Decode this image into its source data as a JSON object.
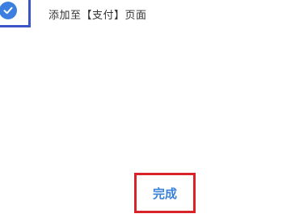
{
  "option": {
    "label": "添加至【支付】页面",
    "checked": true,
    "check_icon": "checkmark-icon",
    "check_color": "#3d7fe0",
    "highlight_color": "#3b55c9"
  },
  "footer": {
    "done_label": "完成",
    "done_color": "#3a82d9",
    "highlight_color": "#d8232a"
  }
}
